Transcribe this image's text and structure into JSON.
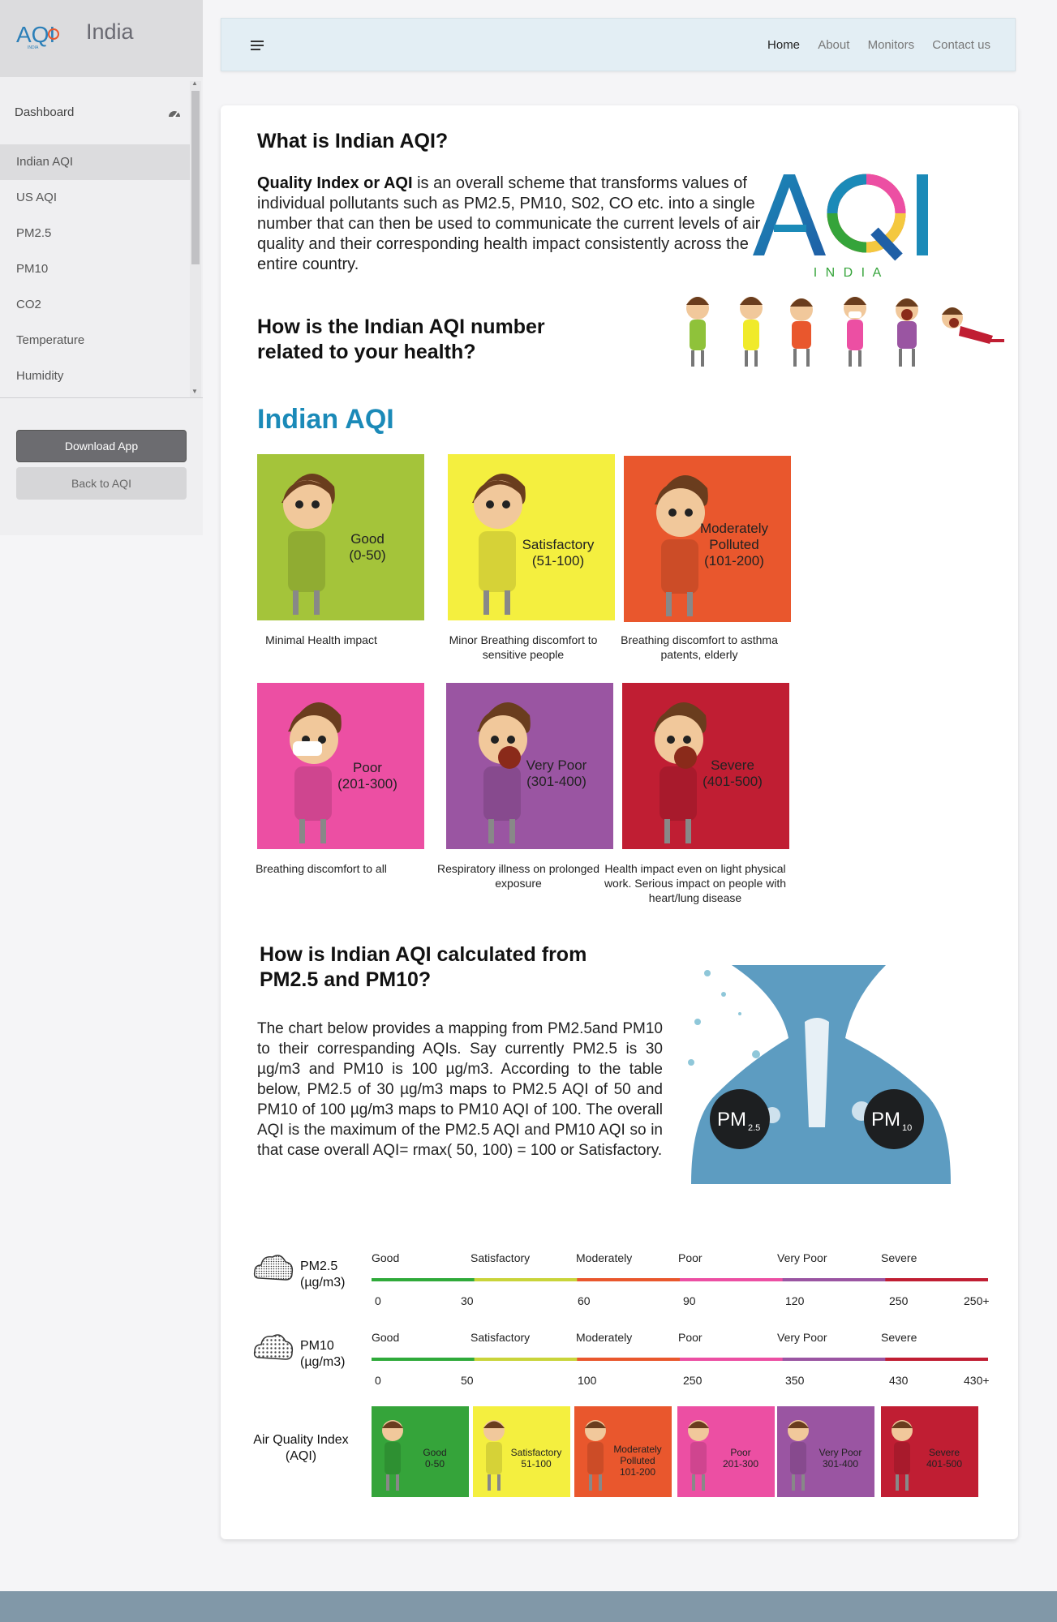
{
  "brand": {
    "logo_text": "AQI",
    "region": "India"
  },
  "sidebar": {
    "dashboard_label": "Dashboard",
    "items": [
      {
        "label": "Indian AQI"
      },
      {
        "label": "US AQI"
      },
      {
        "label": "PM2.5"
      },
      {
        "label": "PM10"
      },
      {
        "label": "CO2"
      },
      {
        "label": "Temperature"
      },
      {
        "label": "Humidity"
      }
    ],
    "download_label": "Download App",
    "back_label": "Back to AQI"
  },
  "topnav": {
    "items": [
      {
        "label": "Home"
      },
      {
        "label": "About"
      },
      {
        "label": "Monitors"
      },
      {
        "label": "Contact us"
      }
    ]
  },
  "main": {
    "section1_title": "What is Indian AQI?",
    "intro_bold": "Quality Index or AQI",
    "intro_rest": " is an overall scheme that transforms values of individual pollutants such as PM2.5, PM10, S02, CO etc. into a single number that can then be used to communicate the current levels of air quality and their corresponding health impact consistently across the entire country.",
    "logo_big": "AQI",
    "logo_sub": "I N D I A",
    "section2_title": "How is the Indian AQI number related to your health?",
    "indian_aqi_heading": "Indian AQI",
    "categories": [
      {
        "name": "Good",
        "range": "(0-50)",
        "desc": "Minimal Health impact",
        "color": "#a4c43a"
      },
      {
        "name": "Satisfactory",
        "range": "(51-100)",
        "desc": "Minor Breathing discomfort to sensitive people",
        "color": "#f4ef3f"
      },
      {
        "name": "Moderately Polluted",
        "range": "(101-200)",
        "desc": "Breathing discomfort to asthma patents, elderly",
        "color": "#e9572d"
      },
      {
        "name": "Poor",
        "range": "(201-300)",
        "desc": "Breathing discomfort to all",
        "color": "#ec4fa3"
      },
      {
        "name": "Very Poor",
        "range": "(301-400)",
        "desc": "Respiratory illness on prolonged exposure",
        "color": "#9a55a2"
      },
      {
        "name": "Severe",
        "range": "(401-500)",
        "desc": "Health impact even on light physical work. Serious impact on people with heart/lung disease",
        "color": "#c01e33"
      }
    ],
    "section3_title": "How is Indian AQI calculated from PM2.5 and PM10?",
    "section3_text": "The chart below provides a mapping from PM2.5and PM10 to their correspanding AQIs. Say currently PM2.5 is 30 µg/m3 and PM10 is 100 µg/m3. According to the table below, PM2.5 of 30 µg/m3 maps to PM2.5 AQI of 50 and PM10 of 100 µg/m3 maps to PM10 AQI of 100. The overall AQI is the maximum of the PM2.5 AQI and PM10 AQI so in that case overall AQI= rmax( 50, 100) = 100 or Satisfactory.",
    "lung_labels": {
      "pm25": "PM",
      "pm25_sub": "2.5",
      "pm10": "PM",
      "pm10_sub": "10"
    }
  },
  "scales": {
    "category_labels": [
      "Good",
      "Satisfactory",
      "Moderately",
      "Poor",
      "Very Poor",
      "Severe"
    ],
    "pm25": {
      "name": "PM2.5",
      "unit": "(µg/m3)",
      "ticks": [
        "0",
        "30",
        "60",
        "90",
        "120",
        "250",
        "250+"
      ]
    },
    "pm10": {
      "name": "PM10",
      "unit": "(µg/m3)",
      "ticks": [
        "0",
        "50",
        "100",
        "250",
        "350",
        "430",
        "430+"
      ]
    },
    "aqi_label": "Air Quality Index (AQI)",
    "aqi_boxes": [
      {
        "name": "Good",
        "range": "0-50",
        "color": "#35a43a"
      },
      {
        "name": "Satisfactory",
        "range": "51-100",
        "color": "#f4ef3f"
      },
      {
        "name": "Moderately Polluted",
        "range": "101-200",
        "color": "#e9572d"
      },
      {
        "name": "Poor",
        "range": "201-300",
        "color": "#ec4fa3"
      },
      {
        "name": "Very Poor",
        "range": "301-400",
        "color": "#9a55a2"
      },
      {
        "name": "Severe",
        "range": "401-500",
        "color": "#c01e33"
      }
    ]
  },
  "colors": {
    "accent": "#1b8ab8",
    "footer": "#8198a8",
    "lungs": "#5d9cc1"
  }
}
